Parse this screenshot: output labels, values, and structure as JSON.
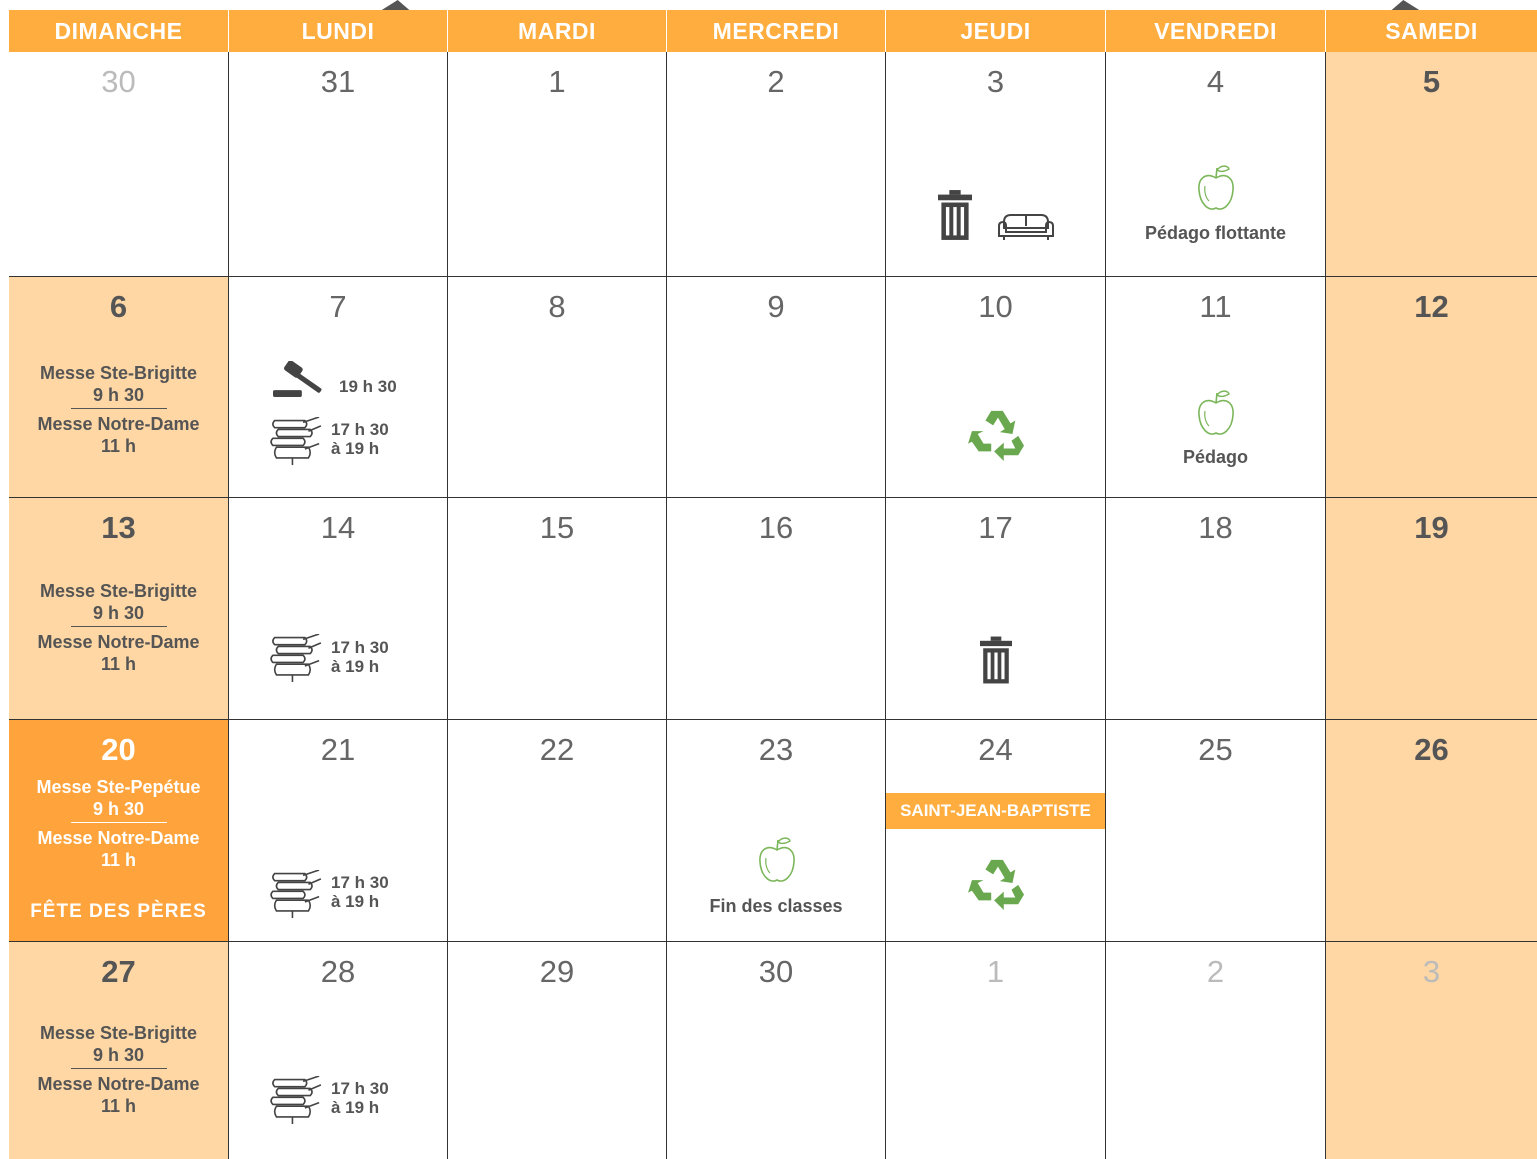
{
  "weekdays": [
    "DIMANCHE",
    "LUNDI",
    "MARDI",
    "MERCREDI",
    "JEUDI",
    "VENDREDI",
    "SAMEDI"
  ],
  "weeks": [
    [
      "30",
      "31",
      "1",
      "2",
      "3",
      "4",
      "5"
    ],
    [
      "6",
      "7",
      "8",
      "9",
      "10",
      "11",
      "12"
    ],
    [
      "13",
      "14",
      "15",
      "16",
      "17",
      "18",
      "19"
    ],
    [
      "20",
      "21",
      "22",
      "23",
      "24",
      "25",
      "26"
    ],
    [
      "27",
      "28",
      "29",
      "30",
      "1",
      "2",
      "3"
    ]
  ],
  "masses": {
    "brigitte": "Messe Ste-Brigitte",
    "pepetue": "Messe Ste-Pepétue",
    "time1": "9 h 30",
    "notredame": "Messe Notre-Dame",
    "time2": "11 h"
  },
  "events": {
    "pedago_flottante": "Pédago flottante",
    "pedago": "Pédago",
    "fin_classes": "Fin des classes",
    "council_time": "19 h 30",
    "library_start": "17 h 30",
    "library_end": "à 19 h",
    "saint_jean": "SAINT-JEAN-BAPTISTE",
    "fete_peres": "FÊTE DES PÈRES"
  },
  "icons": [
    "trash-icon",
    "couch-icon",
    "apple-icon",
    "gavel-icon",
    "books-icon",
    "recycle-icon"
  ],
  "colors": {
    "header": "#ffad3f",
    "weekend": "#ffd7a4",
    "highlight": "#ffa43c",
    "recycle": "#6aa84f",
    "apple": "#7cb65a"
  }
}
